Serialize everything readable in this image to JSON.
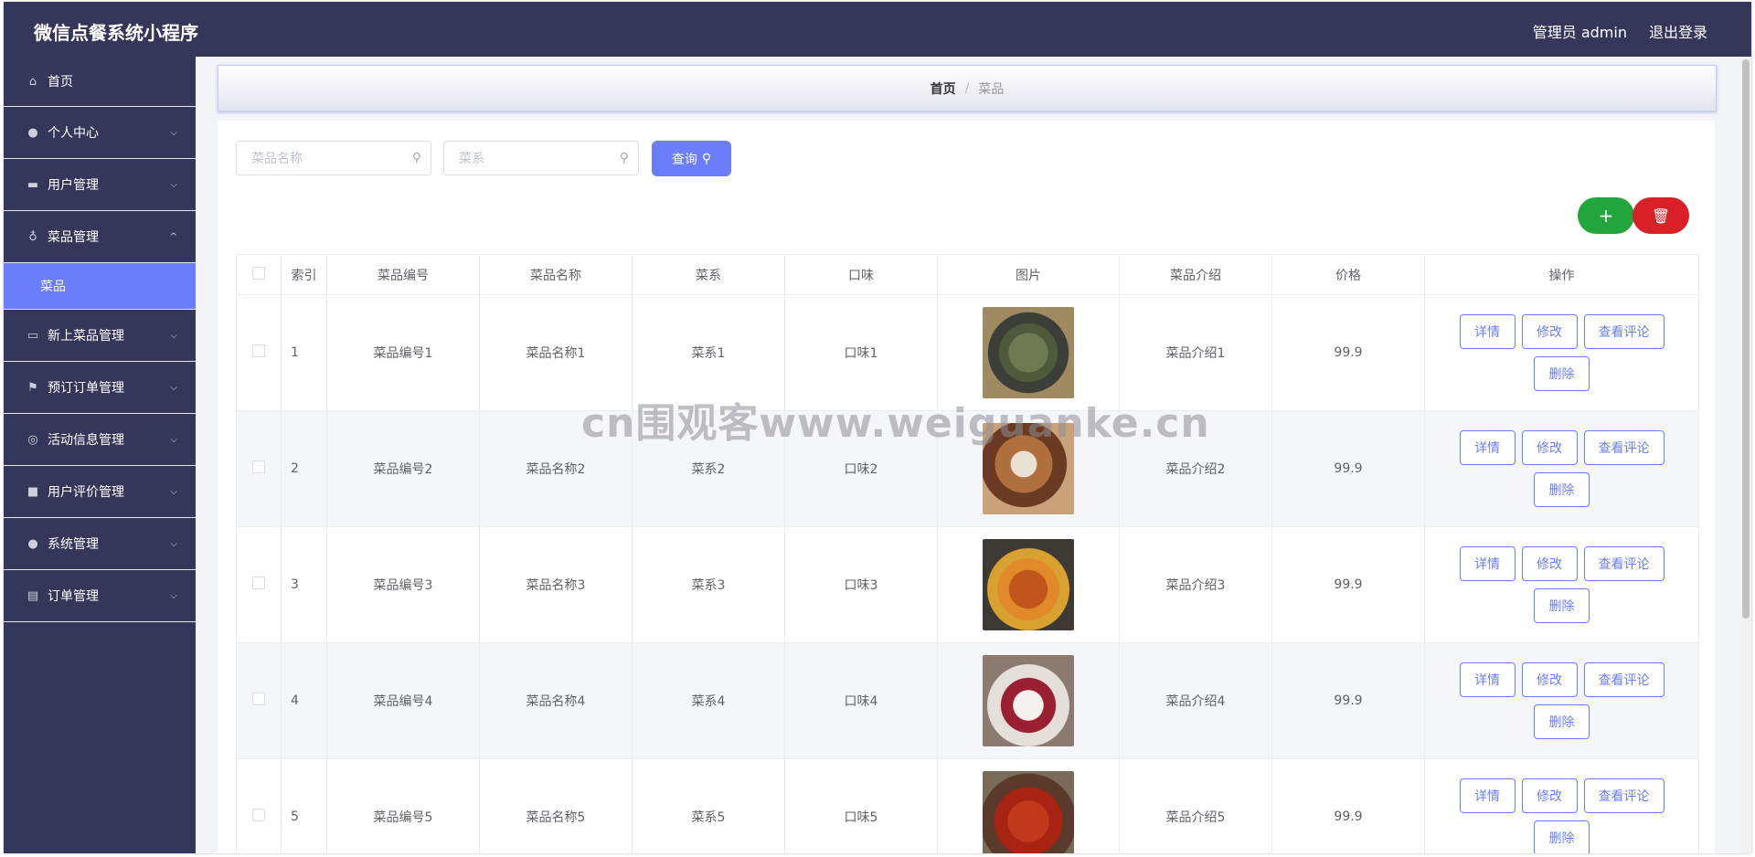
{
  "header": {
    "title": "微信点餐系统小程序",
    "user": "管理员 admin",
    "logout": "退出登录"
  },
  "sidebar": {
    "items": [
      {
        "label": "首页",
        "icon": "home-icon"
      },
      {
        "label": "个人中心",
        "icon": "user-icon"
      },
      {
        "label": "用户管理",
        "icon": "ticket-icon"
      },
      {
        "label": "菜品管理",
        "icon": "mic-icon",
        "sub": "菜品"
      },
      {
        "label": "新上菜品管理",
        "icon": "card-icon"
      },
      {
        "label": "预订订单管理",
        "icon": "flag-icon"
      },
      {
        "label": "活动信息管理",
        "icon": "circle-icon"
      },
      {
        "label": "用户评价管理",
        "icon": "briefcase-icon"
      },
      {
        "label": "系统管理",
        "icon": "user-icon"
      },
      {
        "label": "订单管理",
        "icon": "clipboard-icon"
      }
    ]
  },
  "breadcrumb": {
    "home": "首页",
    "sep": "/",
    "current": "菜品"
  },
  "search": {
    "name_placeholder": "菜品名称",
    "cuisine_placeholder": "菜系",
    "query_label": "查询"
  },
  "table": {
    "headers": [
      "索引",
      "菜品编号",
      "菜品名称",
      "菜系",
      "口味",
      "图片",
      "菜品介绍",
      "价格",
      "操作"
    ],
    "rows": [
      {
        "idx": "1",
        "code": "菜品编号1",
        "name": "菜品名称1",
        "cuisine": "菜系1",
        "taste": "口味1",
        "intro": "菜品介绍1",
        "price": "99.9"
      },
      {
        "idx": "2",
        "code": "菜品编号2",
        "name": "菜品名称2",
        "cuisine": "菜系2",
        "taste": "口味2",
        "intro": "菜品介绍2",
        "price": "99.9"
      },
      {
        "idx": "3",
        "code": "菜品编号3",
        "name": "菜品名称3",
        "cuisine": "菜系3",
        "taste": "口味3",
        "intro": "菜品介绍3",
        "price": "99.9"
      },
      {
        "idx": "4",
        "code": "菜品编号4",
        "name": "菜品名称4",
        "cuisine": "菜系4",
        "taste": "口味4",
        "intro": "菜品介绍4",
        "price": "99.9"
      },
      {
        "idx": "5",
        "code": "菜品编号5",
        "name": "菜品名称5",
        "cuisine": "菜系5",
        "taste": "口味5",
        "intro": "菜品介绍5",
        "price": "99.9"
      }
    ],
    "ops": {
      "detail": "详情",
      "edit": "修改",
      "reviews": "查看评论",
      "delete": "删除"
    }
  },
  "watermark": "cn围观客www.weiguanke.cn",
  "colors": {
    "sidebar": "#35375a",
    "accent": "#6a7efc",
    "add": "#21a53c",
    "delete": "#d82026"
  }
}
